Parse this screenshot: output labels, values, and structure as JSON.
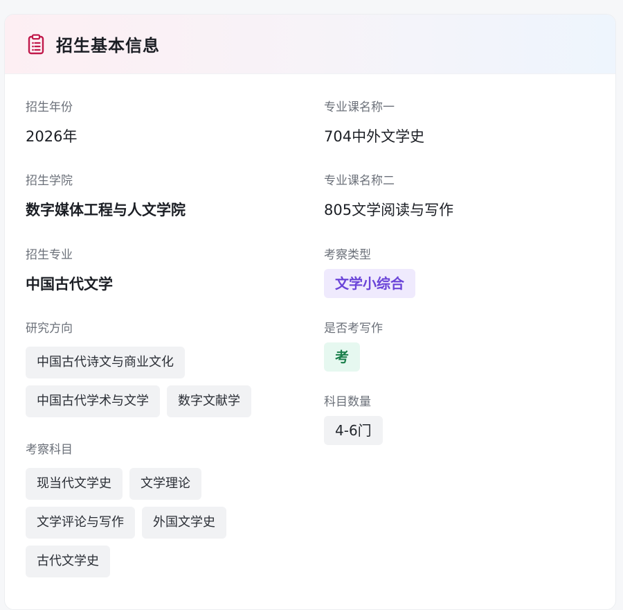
{
  "header": {
    "icon": "clipboard-list-icon",
    "title": "招生基本信息",
    "icon_color": "#c0184a"
  },
  "left": {
    "year": {
      "label": "招生年份",
      "value": "2026年"
    },
    "college": {
      "label": "招生学院",
      "value": "数字媒体工程与人文学院"
    },
    "major": {
      "label": "招生专业",
      "value": "中国古代文学"
    },
    "directions": {
      "label": "研究方向",
      "items": [
        "中国古代诗文与商业文化",
        "中国古代学术与文学",
        "数字文献学"
      ]
    },
    "subjects": {
      "label": "考察科目",
      "items": [
        "现当代文学史",
        "文学理论",
        "文学评论与写作",
        "外国文学史",
        "古代文学史"
      ]
    }
  },
  "right": {
    "course1": {
      "label": "专业课名称一",
      "value": "704中外文学史"
    },
    "course2": {
      "label": "专业课名称二",
      "value": "805文学阅读与写作"
    },
    "exam_type": {
      "label": "考察类型",
      "value": "文学小综合"
    },
    "writing": {
      "label": "是否考写作",
      "value": "考"
    },
    "count": {
      "label": "科目数量",
      "value": "4-6门"
    }
  },
  "colors": {
    "purple_badge_text": "#6a44d8",
    "green_badge_text": "#1a7f4b"
  }
}
